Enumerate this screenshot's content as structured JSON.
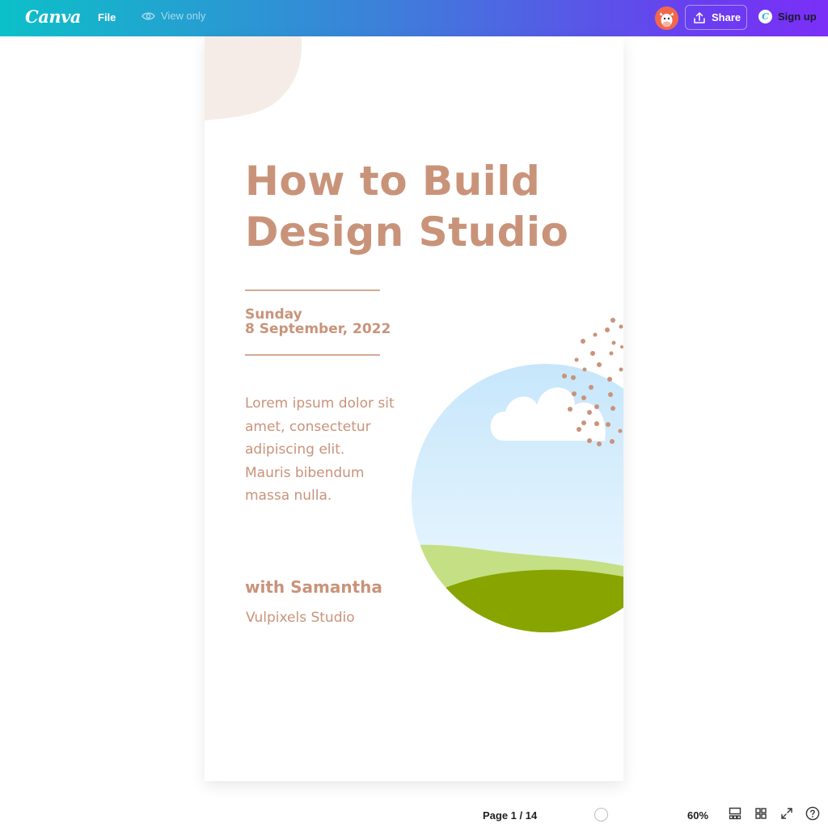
{
  "topbar": {
    "logo": "Canva",
    "file_label": "File",
    "view_only_label": "View only",
    "share_label": "Share",
    "signup_label": "Sign up"
  },
  "design": {
    "title_line1": "How to Build",
    "title_line2": "Design Studio",
    "date_line1": "Sunday",
    "date_line2": "8 September, 2022",
    "body": [
      "Lorem ipsum dolor sit",
      "amet, consectetur",
      "adipiscing elit.",
      "Mauris bibendum",
      "massa nulla."
    ],
    "presenter": "with Samantha",
    "studio": "Vulpixels Studio",
    "accent_color": "#c9937a"
  },
  "footer": {
    "page_indicator": "Page 1 / 14",
    "zoom": "60%"
  }
}
